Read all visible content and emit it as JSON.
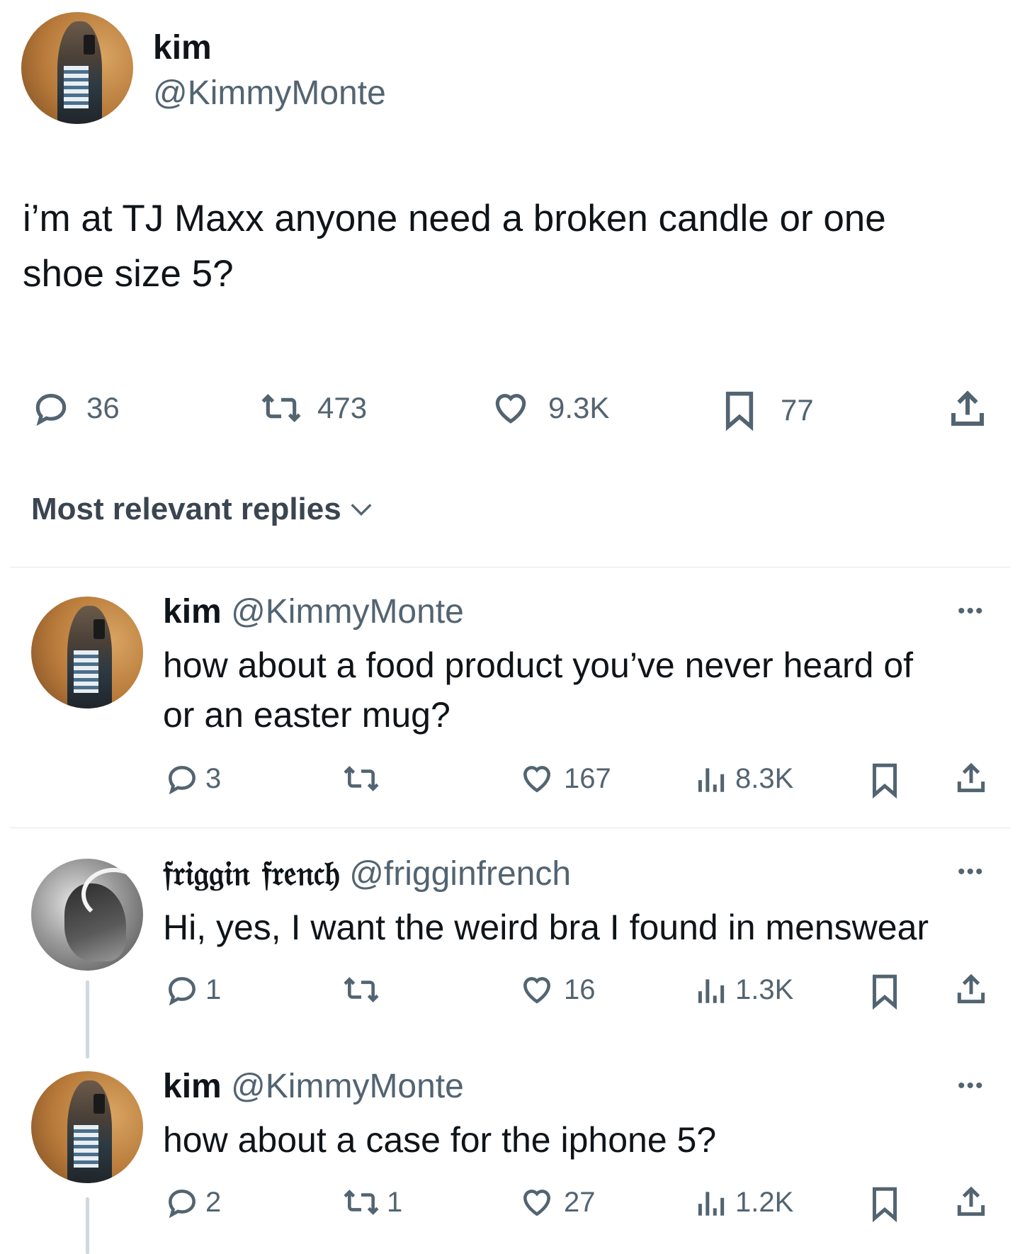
{
  "main_tweet": {
    "author_name": "kim",
    "author_handle": "@KimmyMonte",
    "text_line1": "i’m at TJ Maxx anyone need a broken candle or one",
    "text_line2": "shoe size 5?",
    "stats": {
      "replies": "36",
      "retweets": "473",
      "likes": "9.3K",
      "bookmarks": "77"
    }
  },
  "replies_header": {
    "label": "Most relevant replies"
  },
  "replies": [
    {
      "author_name": "kim",
      "author_handle": "@KimmyMonte",
      "text_line1": "how about a food product you’ve never heard of",
      "text_line2": "or an easter mug?",
      "replies": "3",
      "retweets": "",
      "likes": "167",
      "views": "8.3K"
    },
    {
      "author_name": "𝔣𝔯𝔦𝔤𝔤𝔦𝔫 𝔣𝔯𝔢𝔫𝔠𝔥",
      "author_handle": "@frigginfrench",
      "text_line1": "Hi, yes, I want the weird bra I found in menswear",
      "replies": "1",
      "retweets": "",
      "likes": "16",
      "views": "1.3K"
    },
    {
      "author_name": "kim",
      "author_handle": "@KimmyMonte",
      "text_line1": "how about a case for the iphone 5?",
      "replies": "2",
      "retweets": "1",
      "likes": "27",
      "views": "1.2K"
    }
  ],
  "icons": {
    "reply": "reply-icon",
    "retweet": "retweet-icon",
    "like": "heart-icon",
    "bookmark": "bookmark-icon",
    "views": "views-icon",
    "share": "share-icon",
    "more": "more-icon"
  },
  "colors": {
    "text": "#0f1419",
    "muted": "#536471",
    "divider": "#e6e9ec"
  }
}
